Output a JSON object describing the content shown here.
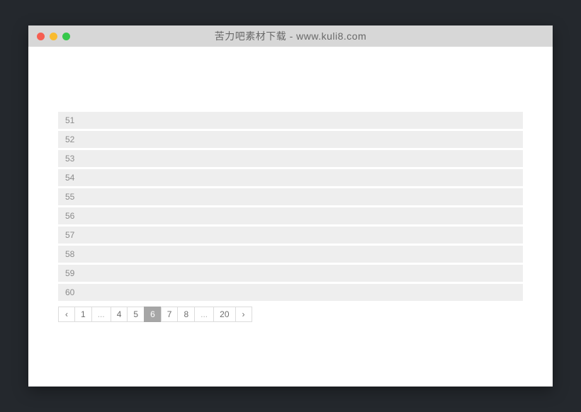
{
  "window": {
    "title": "苦力吧素材下载 - www.kuli8.com"
  },
  "list": {
    "items": [
      "51",
      "52",
      "53",
      "54",
      "55",
      "56",
      "57",
      "58",
      "59",
      "60"
    ]
  },
  "pagination": {
    "prev": "‹",
    "next": "›",
    "ellipsis": "...",
    "pages": [
      "1",
      "...",
      "4",
      "5",
      "6",
      "7",
      "8",
      "...",
      "20"
    ],
    "active": "6"
  }
}
